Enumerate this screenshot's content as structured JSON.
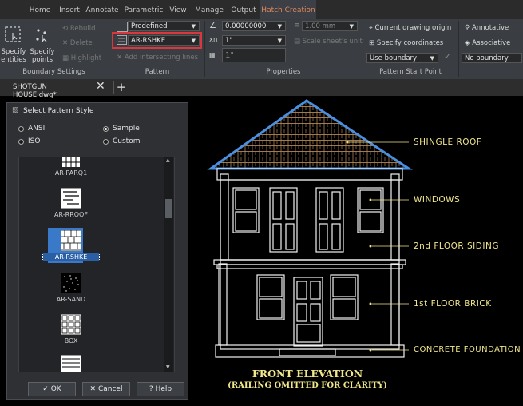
{
  "menu": {
    "tabs": [
      "Home",
      "Insert",
      "Annotate",
      "Parametric",
      "View",
      "Manage",
      "Output",
      "Hatch Creation"
    ],
    "active_tab": "Hatch Creation"
  },
  "ribbon": {
    "boundary": {
      "specify_entities": "Specify entities",
      "specify_points": "Specify points",
      "rebuild": "Rebuild",
      "delete": "Delete",
      "highlight": "Highlight",
      "panel_label": "Boundary Settings"
    },
    "pattern": {
      "type_value": "Predefined",
      "name_value": "AR-RSHKE",
      "add_intersecting": "Add intersecting lines",
      "panel_label": "Pattern"
    },
    "properties": {
      "angle_value": "0.00000000",
      "scale_value": "1\"",
      "spacing_value": "1\"",
      "lineweight_value": "1.00 mm",
      "scale_sheet_unit": "Scale sheet's unit",
      "panel_label": "Properties"
    },
    "origin": {
      "current_origin": "Current drawing origin",
      "specify_coordinates": "Specify coordinates",
      "use_boundary": "Use boundary",
      "panel_label": "Pattern Start Point"
    },
    "options": {
      "annotative": "Annotative",
      "associative": "Associative",
      "no_boundary": "No boundary"
    }
  },
  "doc_tab": {
    "filename": "SHOTGUN HOUSE.dwg*"
  },
  "dialog": {
    "title": "Select Pattern Style",
    "radio_ansi": "ANSI",
    "radio_iso": "ISO",
    "radio_sample": "Sample",
    "radio_custom": "Custom",
    "selected_radio": "Sample",
    "patterns": [
      "AR-PARQ1",
      "AR-RROOF",
      "AR-RSHKE",
      "AR-SAND",
      "BOX"
    ],
    "selected_pattern": "AR-RSHKE",
    "ok_label": "OK",
    "cancel_label": "Cancel",
    "help_label": "Help"
  },
  "drawing": {
    "labels": {
      "shingle_roof": "SHINGLE ROOF",
      "windows": "WINDOWS",
      "second_floor": "2nd FLOOR SIDING",
      "first_floor": "1st FLOOR BRICK",
      "foundation": "CONCRETE FOUNDATION"
    },
    "title": "FRONT ELEVATION",
    "subtitle": "(RAILING OMITTED FOR CLARITY)"
  },
  "colors": {
    "accent_orange": "#e08a5a",
    "selection_blue": "#3a78c8",
    "roof_outline_blue": "#4a90e2",
    "label_yellow": "#f0e68c",
    "pattern_highlight_red": "#d9363e"
  }
}
